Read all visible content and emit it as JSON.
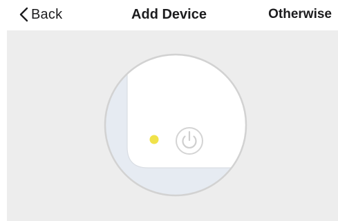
{
  "nav": {
    "back_label": "Back",
    "title": "Add Device",
    "otherwise_label": "Otherwise"
  },
  "illustration": {
    "icons": [
      "chevron-left-icon",
      "indicator-light-icon",
      "power-icon"
    ],
    "indicator_color": "#f0e24a",
    "device_body_color": "#ffffff",
    "background_edge_color": "#e6ebf2",
    "circle_border_color": "#d2d2d2",
    "panel_color": "#ededed"
  }
}
